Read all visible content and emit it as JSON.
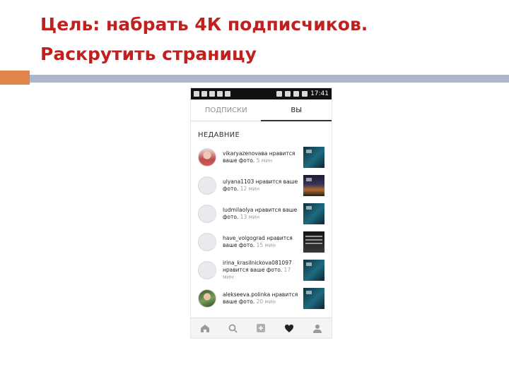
{
  "slide": {
    "title_line1": "Цель: набрать 4К подписчиков.",
    "title_line2": "Раскрутить страницу"
  },
  "phone": {
    "status_time": "17:41",
    "tabs": [
      {
        "label": "ПОДПИСКИ",
        "active": false
      },
      {
        "label": "ВЫ",
        "active": true
      }
    ],
    "section_title": "НЕДАВНИЕ",
    "activity": [
      {
        "user": "vikaryazenovaвa",
        "action": " нравится ваше фото.",
        "time": " 5 мин",
        "avatar": "photo"
      },
      {
        "user": "ulyana1103",
        "action": " нравится ваше фото.",
        "time": " 12 мин",
        "avatar": "blank"
      },
      {
        "user": "ludmilaolya",
        "action": " нравится ваше фото.",
        "time": " 13 мин",
        "avatar": "blank"
      },
      {
        "user": "have_volgograd",
        "action": " нравится ваше фото.",
        "time": " 15 мин",
        "avatar": "blank"
      },
      {
        "user": "irina_krasilnickova081097",
        "action": " нравится ваше фото.",
        "time": " 17 мин",
        "avatar": "blank"
      },
      {
        "user": "alekseeva.polinka",
        "action": " нравится ваше фото.",
        "time": " 20 мин",
        "avatar": "photo"
      }
    ],
    "nav_icons": [
      "home-icon",
      "search-icon",
      "add-post-icon",
      "heart-icon",
      "profile-icon"
    ]
  },
  "colors": {
    "title": "#c0211f",
    "accent_bar": "#e0844a",
    "rule": "#aab8c8"
  }
}
